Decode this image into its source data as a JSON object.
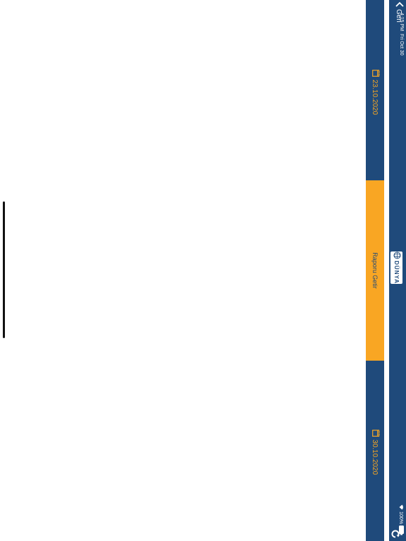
{
  "status_bar": {
    "time": "4:15 PM",
    "date": "Fri Oct 30",
    "battery": "100%"
  },
  "nav": {
    "back_label": "Geri",
    "logo_text": "DÜNYA",
    "logo_icon": "globe-icon",
    "refresh_icon": "refresh-icon"
  },
  "toolbar": {
    "start_date": "23.10.2020",
    "end_date": "30.10.2020",
    "calendar_icon": "calendar-icon",
    "report_button_label": "Raporu Getir"
  },
  "colors": {
    "primary": "#1f4a7b",
    "accent": "#f9a623",
    "background": "#ffffff"
  }
}
